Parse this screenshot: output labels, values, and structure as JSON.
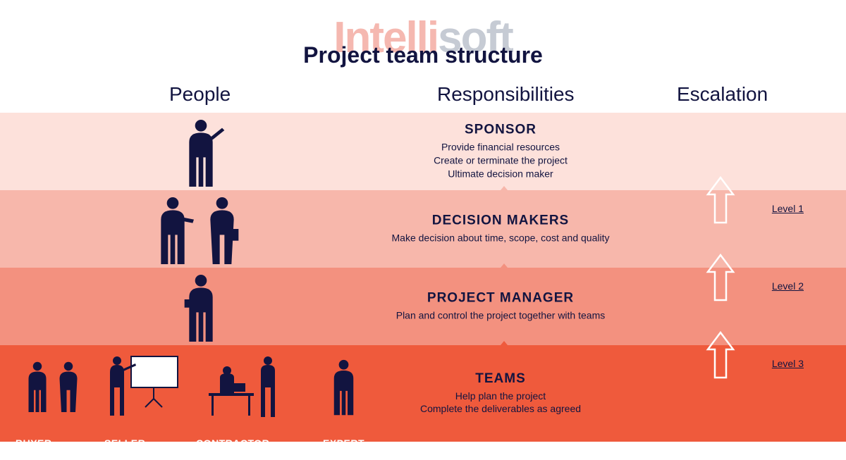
{
  "watermark": {
    "part1": "Intelli",
    "part2": "soft"
  },
  "title": "Project team structure",
  "columns": {
    "people": "People",
    "resp": "Responsibilities",
    "esc": "Escalation"
  },
  "rows": [
    {
      "role": "SPONSOR",
      "lines": [
        "Provide financial resources",
        "Create or terminate the project",
        "Ultimate decision maker"
      ]
    },
    {
      "role": "DECISION MAKERS",
      "lines": [
        "Make decision about time, scope, cost and quality"
      ]
    },
    {
      "role": "PROJECT MANAGER",
      "lines": [
        "Plan and control the project together with teams"
      ]
    },
    {
      "role": "TEAMS",
      "lines": [
        "Help plan the project",
        "Complete the deliverables as agreed"
      ]
    }
  ],
  "escalation": [
    "Level 1",
    "Level 2",
    "Level 3"
  ],
  "team_labels": [
    "BUYER TEAM",
    "SELLER TEAM",
    "CONTRACTOR TEAM",
    "EXPERT"
  ]
}
